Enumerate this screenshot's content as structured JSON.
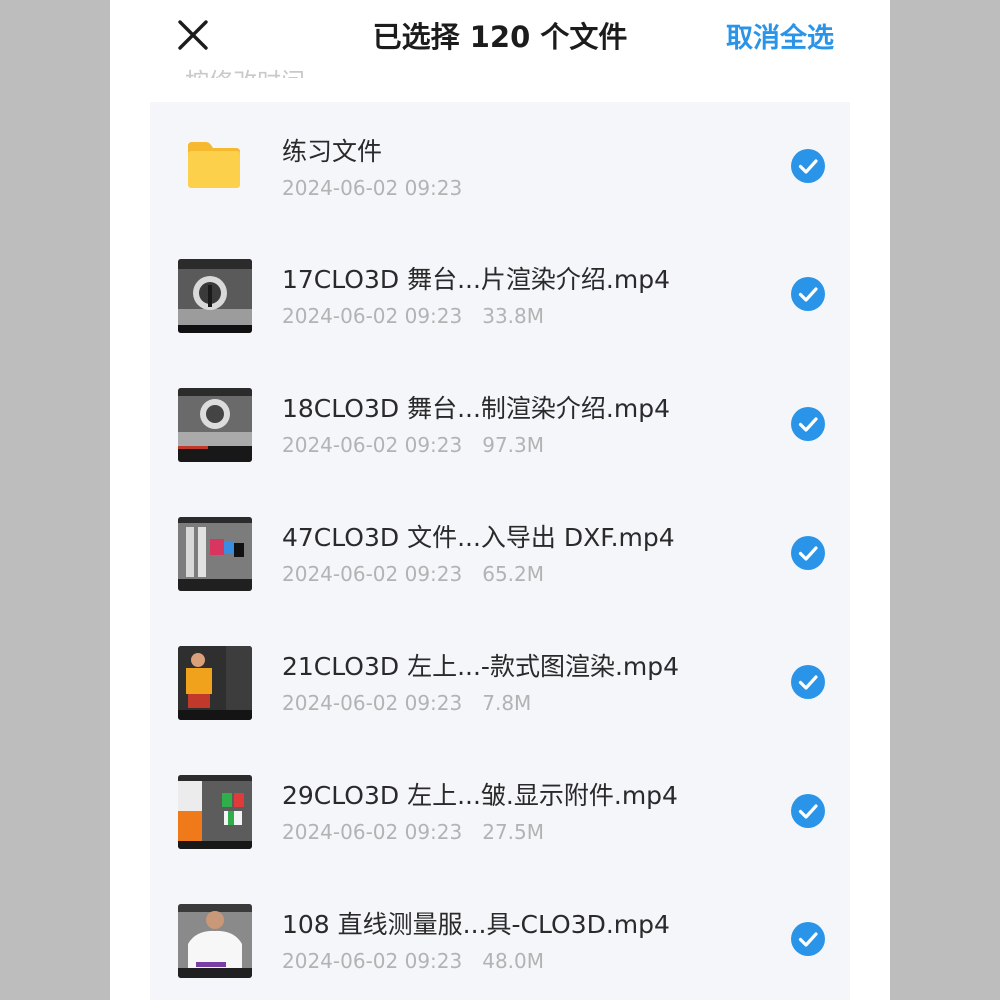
{
  "header": {
    "title": "已选择 120 个文件",
    "cancel_label": "取消全选",
    "ghost_text": "按修改时间"
  },
  "colors": {
    "accent": "#2a95e8",
    "folder": "#fcc93b",
    "list_bg": "#f4f6f9"
  },
  "files": [
    {
      "name": "练习文件",
      "date": "2024-06-02 09:23",
      "size": "",
      "type": "folder",
      "icon": "folder-icon",
      "selected": true
    },
    {
      "name": "17CLO3D 舞台...片渲染介绍.mp4",
      "date": "2024-06-02 09:23",
      "size": "33.8M",
      "type": "video",
      "icon": "video-thumbnail",
      "selected": true
    },
    {
      "name": "18CLO3D 舞台...制渲染介绍.mp4",
      "date": "2024-06-02 09:23",
      "size": "97.3M",
      "type": "video",
      "icon": "video-thumbnail",
      "selected": true
    },
    {
      "name": "47CLO3D 文件...入导出 DXF.mp4",
      "date": "2024-06-02 09:23",
      "size": "65.2M",
      "type": "video",
      "icon": "video-thumbnail",
      "selected": true
    },
    {
      "name": "21CLO3D 左上...-款式图渲染.mp4",
      "date": "2024-06-02 09:23",
      "size": "7.8M",
      "type": "video",
      "icon": "video-thumbnail",
      "selected": true
    },
    {
      "name": "29CLO3D 左上...皱.显示附件.mp4",
      "date": "2024-06-02 09:23",
      "size": "27.5M",
      "type": "video",
      "icon": "video-thumbnail",
      "selected": true
    },
    {
      "name": "108 直线测量服...具-CLO3D.mp4",
      "date": "2024-06-02 09:23",
      "size": "48.0M",
      "type": "video",
      "icon": "video-thumbnail",
      "selected": true
    }
  ]
}
